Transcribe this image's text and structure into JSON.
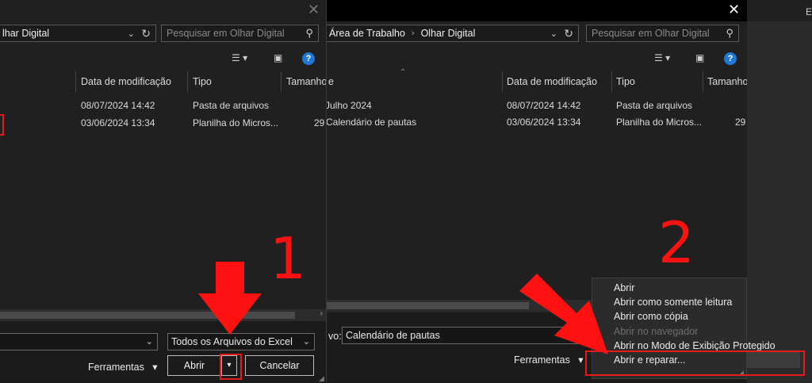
{
  "left": {
    "address": "lhar Digital",
    "search_placeholder": "Pesquisar em Olhar Digital",
    "columns": [
      "Data de modificação",
      "Tipo",
      "Tamanho"
    ],
    "rows": [
      {
        "date": "08/07/2024 14:42",
        "type": "Pasta de arquivos",
        "size": ""
      },
      {
        "date": "03/06/2024 13:34",
        "type": "Planilha do Micros...",
        "size": "29"
      }
    ],
    "filter": "Todos os Arquivos do Excel",
    "tools": "Ferramentas",
    "open": "Abrir",
    "cancel": "Cancelar",
    "step_number": "1"
  },
  "right": {
    "breadcrumb": [
      "Área de Trabalho",
      "Olhar Digital"
    ],
    "search_placeholder": "Pesquisar em Olhar Digital",
    "columns": [
      "e",
      "Data de modificação",
      "Tipo",
      "Tamanho"
    ],
    "rows": [
      {
        "name": "Julho 2024",
        "date": "08/07/2024 14:42",
        "type": "Pasta de arquivos",
        "size": ""
      },
      {
        "name": "Calendário de pautas",
        "date": "03/06/2024 13:34",
        "type": "Planilha do Micros...",
        "size": "29"
      }
    ],
    "filename_label": "vo:",
    "filename": "Calendário de pautas",
    "tools": "Ferramentas",
    "menu": [
      "Abrir",
      "Abrir como somente leitura",
      "Abrir como cópia",
      "Abrir no navegador",
      "Abrir no Modo de Exibição Protegido",
      "Abrir e reparar..."
    ],
    "step_number": "2"
  },
  "far_right_text": "E",
  "colors": {
    "annotation_red": "#ff1111",
    "help_blue": "#1e78d6"
  }
}
